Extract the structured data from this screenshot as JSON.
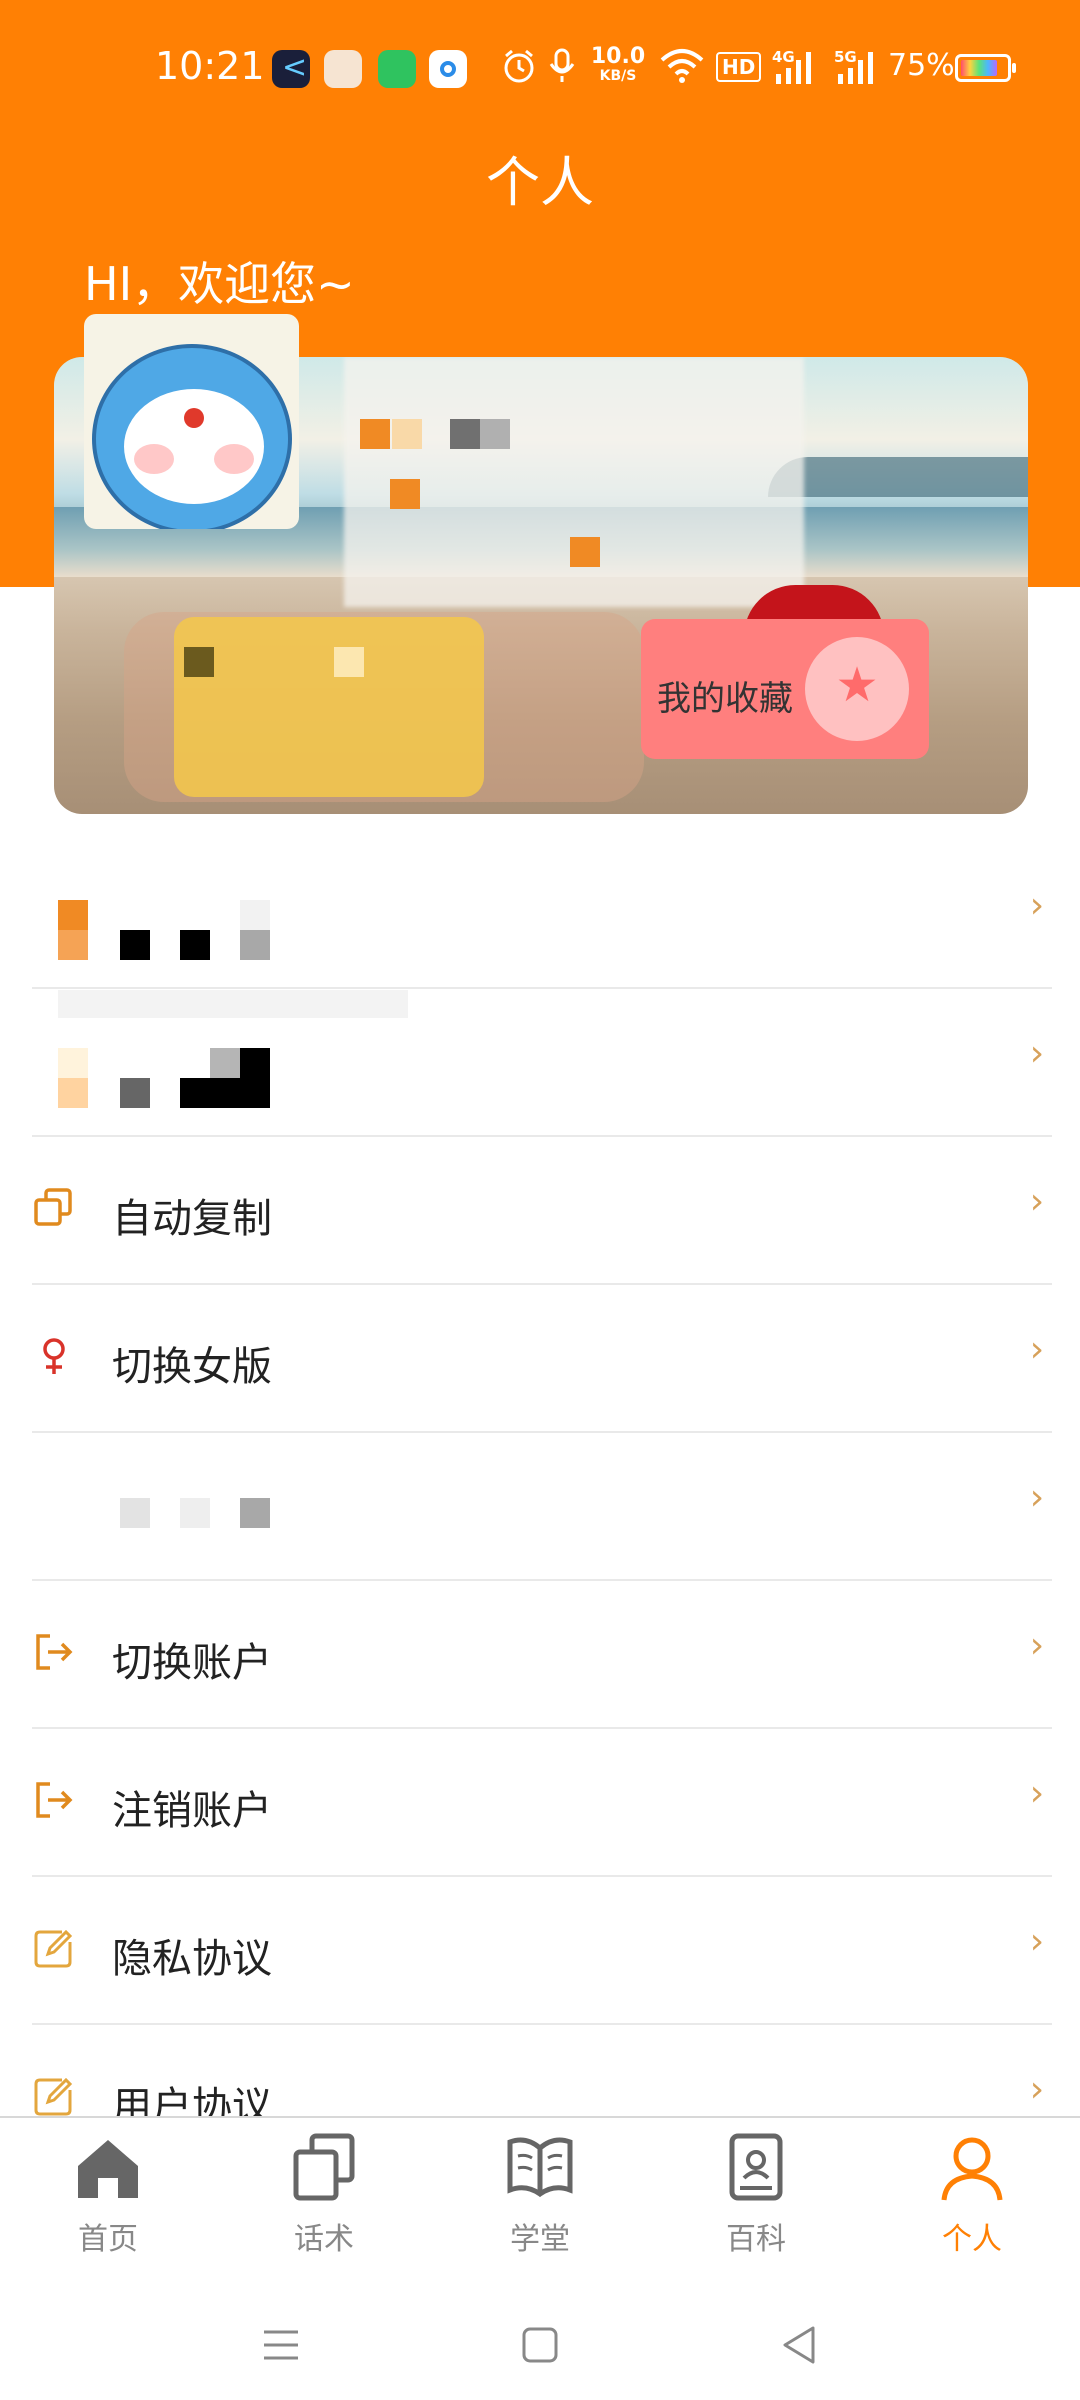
{
  "status_bar": {
    "time": "10:21",
    "net_speed_value": "10.0",
    "net_speed_unit": "KB/S",
    "hd_badge": "HD",
    "sig1_net": "4G",
    "sig2_net": "5G",
    "battery": "75%",
    "icons": [
      "app-notification-icon",
      "alarm-icon",
      "mic-icon",
      "wifi-icon",
      "signal-icon",
      "battery-icon"
    ]
  },
  "header": {
    "title": "个人",
    "greeting": "HI，欢迎您~"
  },
  "profile": {
    "favorites_label": "我的收藏"
  },
  "menu": {
    "items": [
      {
        "label": "",
        "icon": "pixelated-icon",
        "redacted": true
      },
      {
        "label": "",
        "icon": "pixelated-icon",
        "redacted": true
      },
      {
        "label": "自动复制",
        "icon": "copy-icon"
      },
      {
        "label": "切换女版",
        "icon": "female-icon"
      },
      {
        "label": "",
        "icon": "pixelated-icon",
        "redacted": true
      },
      {
        "label": "切换账户",
        "icon": "logout-icon"
      },
      {
        "label": "注销账户",
        "icon": "logout-icon"
      },
      {
        "label": "隐私协议",
        "icon": "edit-icon"
      },
      {
        "label": "用户协议",
        "icon": "edit-icon"
      }
    ]
  },
  "bottom_nav": {
    "items": [
      {
        "label": "首页",
        "icon": "home-icon"
      },
      {
        "label": "话术",
        "icon": "copy-icon"
      },
      {
        "label": "学堂",
        "icon": "book-icon"
      },
      {
        "label": "百科",
        "icon": "encyclopedia-icon"
      },
      {
        "label": "个人",
        "icon": "person-icon",
        "active": true
      }
    ]
  },
  "colors": {
    "accent": "#ff8004",
    "chevron": "#d7a15a",
    "favorite": "#ff7f7e"
  }
}
